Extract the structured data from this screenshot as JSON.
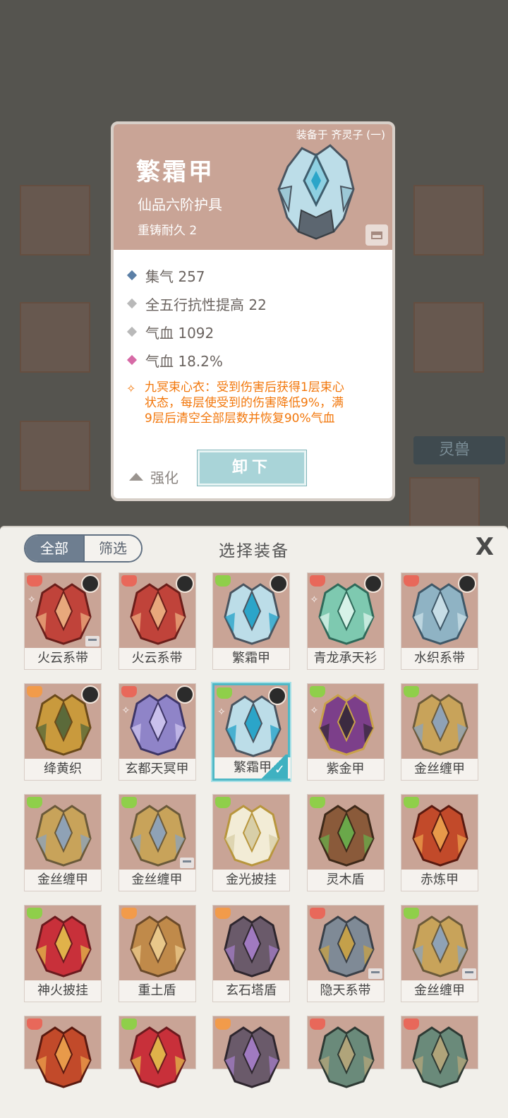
{
  "detail": {
    "equipped_to": "装备于 齐灵子 (一)",
    "name": "繁霜甲",
    "grade": "仙品六阶护具",
    "recast": "重铸耐久 2",
    "stats": [
      {
        "label": "集气 257",
        "color": "#5b7fa6"
      },
      {
        "label": "全五行抗性提高 22",
        "color": "#b9b9b9"
      },
      {
        "label": "气血 1092",
        "color": "#b9b9b9"
      },
      {
        "label": "气血 18.2%",
        "color": "#d66aa6"
      }
    ],
    "effect_lines": [
      "九冥束心衣：受到伤害后获得1层束心",
      "状态，每层使受到的伤害降低9%，满",
      "9层后清空全部层数并恢复90%气血"
    ],
    "strengthen_label": "强化",
    "unequip_label": "卸下"
  },
  "background": {
    "tag_label": "灵兽"
  },
  "panel": {
    "filter_all": "全部",
    "filter_screen": "筛选",
    "title": "选择装备",
    "close_label": "X"
  },
  "colors": {
    "type_green": "#8fcf4a",
    "type_red": "#e8685a",
    "type_orange": "#f29b4a",
    "selected": "#4fb8c6"
  },
  "equipment": [
    {
      "name": "火云系带",
      "type": "red",
      "avatar": true,
      "mark": true,
      "lock": true,
      "art": "red-belt",
      "selected": false
    },
    {
      "name": "火云系带",
      "type": "red",
      "avatar": true,
      "mark": false,
      "lock": false,
      "art": "red-belt",
      "selected": false
    },
    {
      "name": "繁霜甲",
      "type": "green",
      "avatar": true,
      "mark": false,
      "lock": false,
      "art": "ice-armor",
      "selected": false
    },
    {
      "name": "青龙承天衫",
      "type": "red",
      "avatar": true,
      "mark": true,
      "lock": false,
      "art": "green-robe",
      "selected": false
    },
    {
      "name": "水织系带",
      "type": "red",
      "avatar": true,
      "mark": false,
      "lock": false,
      "art": "blue-belt",
      "selected": false
    },
    {
      "name": "绛黄织",
      "type": "orange",
      "avatar": true,
      "mark": false,
      "lock": false,
      "art": "gold-robe",
      "selected": false
    },
    {
      "name": "玄都天冥甲",
      "type": "red",
      "avatar": true,
      "mark": true,
      "lock": false,
      "art": "purple-armor",
      "selected": false
    },
    {
      "name": "繁霜甲",
      "type": "green",
      "avatar": true,
      "mark": true,
      "lock": false,
      "art": "ice-armor",
      "selected": true
    },
    {
      "name": "紫金甲",
      "type": "green",
      "avatar": false,
      "mark": true,
      "lock": false,
      "art": "purple-gold",
      "selected": false
    },
    {
      "name": "金丝缠甲",
      "type": "green",
      "avatar": false,
      "mark": false,
      "lock": false,
      "art": "gold-vest",
      "selected": false
    },
    {
      "name": "金丝缠甲",
      "type": "green",
      "avatar": false,
      "mark": false,
      "lock": false,
      "art": "gold-vest",
      "selected": false
    },
    {
      "name": "金丝缠甲",
      "type": "green",
      "avatar": false,
      "mark": false,
      "lock": true,
      "art": "gold-vest",
      "selected": false
    },
    {
      "name": "金光披挂",
      "type": "green",
      "avatar": false,
      "mark": false,
      "lock": false,
      "art": "white-cloak",
      "selected": false
    },
    {
      "name": "灵木盾",
      "type": "green",
      "avatar": false,
      "mark": false,
      "lock": false,
      "art": "wood-shield",
      "selected": false
    },
    {
      "name": "赤炼甲",
      "type": "green",
      "avatar": false,
      "mark": false,
      "lock": false,
      "art": "red-armor",
      "selected": false
    },
    {
      "name": "神火披挂",
      "type": "green",
      "avatar": false,
      "mark": false,
      "lock": false,
      "art": "red-cloak",
      "selected": false
    },
    {
      "name": "重土盾",
      "type": "orange",
      "avatar": false,
      "mark": false,
      "lock": false,
      "art": "earth-shield",
      "selected": false
    },
    {
      "name": "玄石塔盾",
      "type": "orange",
      "avatar": false,
      "mark": false,
      "lock": false,
      "art": "stone-shield",
      "selected": false
    },
    {
      "name": "隐天系带",
      "type": "red",
      "avatar": false,
      "mark": false,
      "lock": true,
      "art": "grey-belt",
      "selected": false
    },
    {
      "name": "金丝缠甲",
      "type": "green",
      "avatar": false,
      "mark": false,
      "lock": true,
      "art": "gold-vest",
      "selected": false
    },
    {
      "name": "",
      "type": "red",
      "avatar": false,
      "mark": false,
      "lock": false,
      "art": "red-armor",
      "selected": false
    },
    {
      "name": "",
      "type": "green",
      "avatar": false,
      "mark": false,
      "lock": false,
      "art": "red-cloak",
      "selected": false
    },
    {
      "name": "",
      "type": "orange",
      "avatar": false,
      "mark": false,
      "lock": false,
      "art": "stone-shield",
      "selected": false
    },
    {
      "name": "",
      "type": "red",
      "avatar": false,
      "mark": false,
      "lock": false,
      "art": "jade-belt",
      "selected": false
    },
    {
      "name": "",
      "type": "red",
      "avatar": false,
      "mark": false,
      "lock": false,
      "art": "jade-belt",
      "selected": false
    }
  ]
}
